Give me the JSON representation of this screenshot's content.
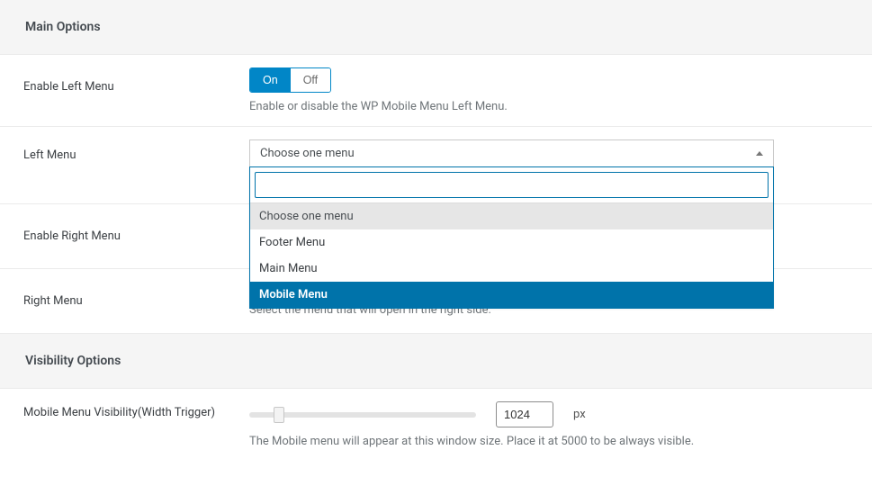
{
  "sections": {
    "main_options": {
      "title": "Main Options"
    },
    "visibility_options": {
      "title": "Visibility Options"
    }
  },
  "enable_left_menu": {
    "label": "Enable Left Menu",
    "on": "On",
    "off": "Off",
    "desc": "Enable or disable the WP Mobile Menu Left Menu."
  },
  "left_menu": {
    "label": "Left Menu",
    "selected": "Choose one menu",
    "search_value": "",
    "options": {
      "placeholder": "Choose one menu",
      "footer": "Footer Menu",
      "main": "Main Menu",
      "mobile": "Mobile Menu"
    }
  },
  "enable_right_menu": {
    "label": "Enable Right Menu"
  },
  "right_menu": {
    "label": "Right Menu",
    "desc": "Select the menu that will open in the right side."
  },
  "visibility_trigger": {
    "label": "Mobile Menu Visibility(Width Trigger)",
    "value": "1024",
    "unit": "px",
    "desc": "The Mobile menu will appear at this window size. Place it at 5000 to be always visible."
  }
}
